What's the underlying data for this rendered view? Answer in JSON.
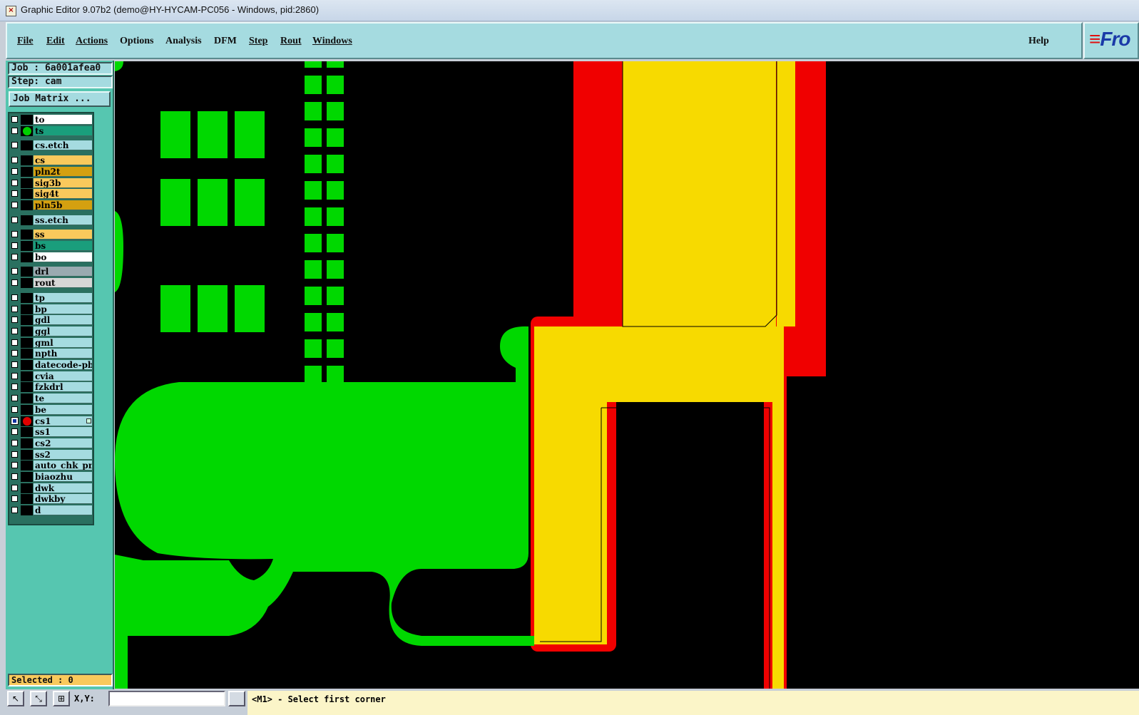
{
  "window": {
    "title": "Graphic Editor 9.07b2 (demo@HY-HYCAM-PC056 - Windows, pid:2860)"
  },
  "menu": {
    "items": [
      {
        "label": "File",
        "key": "file"
      },
      {
        "label": "Edit",
        "key": "edit"
      },
      {
        "label": "Actions",
        "key": "actions"
      },
      {
        "label": "Options",
        "key": "options"
      },
      {
        "label": "Analysis",
        "key": "analysis"
      },
      {
        "label": "DFM",
        "key": "dfm"
      },
      {
        "label": "Step",
        "key": "step"
      },
      {
        "label": "Rout",
        "key": "rout"
      },
      {
        "label": "Windows",
        "key": "windows"
      }
    ],
    "help": "Help"
  },
  "logo": {
    "text_prefix": "Fr",
    "text_rest": "o"
  },
  "left_panel": {
    "job": "Job : 6a001afea0",
    "step": "Step: cam",
    "job_matrix": "Job Matrix ...",
    "selected": "Selected : 0",
    "layers": [
      {
        "name": "to",
        "color": "#ffffff",
        "affected": "",
        "gap": false
      },
      {
        "name": "ts",
        "color": "#1a9e7c",
        "affected": "#00d000",
        "gap": false
      },
      {
        "name": "cs.etch",
        "color": "#a5dbe0",
        "affected": "",
        "gap": true
      },
      {
        "name": "cs",
        "color": "#f9c95c",
        "affected": "",
        "gap": true
      },
      {
        "name": "pln2t",
        "color": "#d4a010",
        "affected": "",
        "gap": false
      },
      {
        "name": "sig3b",
        "color": "#f9c95c",
        "affected": "",
        "gap": false
      },
      {
        "name": "sig4t",
        "color": "#f9c95c",
        "affected": "",
        "gap": false
      },
      {
        "name": "pln5b",
        "color": "#d4a010",
        "affected": "",
        "gap": false
      },
      {
        "name": "ss.etch",
        "color": "#a5dbe0",
        "affected": "",
        "gap": true
      },
      {
        "name": "ss",
        "color": "#f9c95c",
        "affected": "",
        "gap": true
      },
      {
        "name": "bs",
        "color": "#1a9e7c",
        "affected": "",
        "gap": false
      },
      {
        "name": "bo",
        "color": "#ffffff",
        "affected": "",
        "gap": false
      },
      {
        "name": "drl",
        "color": "#9aaab0",
        "affected": "",
        "gap": true
      },
      {
        "name": "rout",
        "color": "#d6d6d6",
        "affected": "",
        "gap": false
      },
      {
        "name": "tp",
        "color": "#a5dbe0",
        "affected": "",
        "gap": true
      },
      {
        "name": "bp",
        "color": "#a5dbe0",
        "affected": "",
        "gap": false
      },
      {
        "name": "gdl",
        "color": "#a5dbe0",
        "affected": "",
        "gap": false
      },
      {
        "name": "ggl",
        "color": "#a5dbe0",
        "affected": "",
        "gap": false
      },
      {
        "name": "gml",
        "color": "#a5dbe0",
        "affected": "",
        "gap": false
      },
      {
        "name": "npth",
        "color": "#a5dbe0",
        "affected": "",
        "gap": false
      },
      {
        "name": "datecode-pbe",
        "color": "#a5dbe0",
        "affected": "",
        "gap": false
      },
      {
        "name": "cvia",
        "color": "#a5dbe0",
        "affected": "",
        "gap": false
      },
      {
        "name": "fzkdrl",
        "color": "#a5dbe0",
        "affected": "",
        "gap": false
      },
      {
        "name": "te",
        "color": "#a5dbe0",
        "affected": "",
        "gap": false
      },
      {
        "name": "be",
        "color": "#a5dbe0",
        "affected": "",
        "gap": false
      },
      {
        "name": "cs1",
        "color": "#a5dbe0",
        "affected": "#e00000",
        "gap": false,
        "checked": true,
        "mark": true
      },
      {
        "name": "ss1",
        "color": "#a5dbe0",
        "affected": "",
        "gap": false
      },
      {
        "name": "cs2",
        "color": "#a5dbe0",
        "affected": "",
        "gap": false
      },
      {
        "name": "ss2",
        "color": "#a5dbe0",
        "affected": "",
        "gap": false
      },
      {
        "name": "auto_chk_pnl",
        "color": "#a5dbe0",
        "affected": "",
        "gap": false
      },
      {
        "name": "biaozhu",
        "color": "#a5dbe0",
        "affected": "",
        "gap": false
      },
      {
        "name": "dwk",
        "color": "#a5dbe0",
        "affected": "",
        "gap": false
      },
      {
        "name": "dwkby",
        "color": "#a5dbe0",
        "affected": "",
        "gap": false
      },
      {
        "name": "d",
        "color": "#a5dbe0",
        "affected": "",
        "gap": false
      }
    ]
  },
  "canvas_colors": {
    "green": "#00d800",
    "yellow": "#f7da00",
    "red": "#f00000",
    "background": "#000000"
  },
  "statusbar": {
    "xy_label": "X,Y:",
    "message": "<M1> - Select first corner"
  },
  "icons": {
    "cursor_mode": "pointer-icon",
    "zoom_mode": "zoom-icon",
    "grid_mode": "grid-icon"
  }
}
